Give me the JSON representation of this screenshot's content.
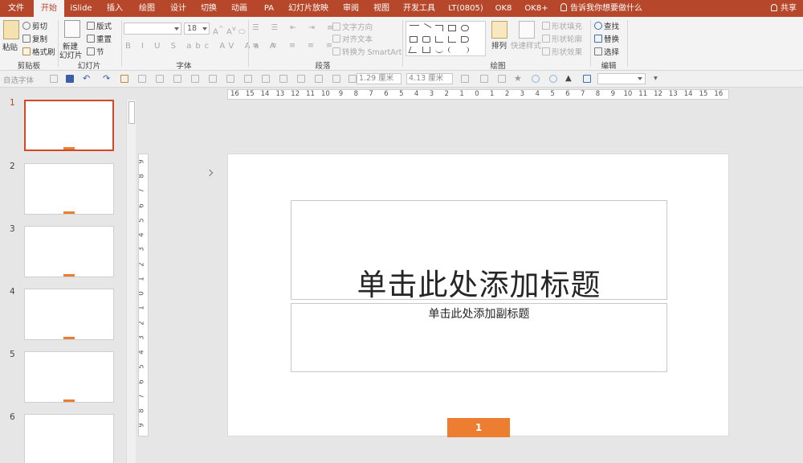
{
  "tabs": [
    "文件",
    "开始",
    "iSlide",
    "插入",
    "绘图",
    "设计",
    "切换",
    "动画",
    "PA",
    "幻灯片放映",
    "审阅",
    "视图",
    "开发工具",
    "LT(0805)",
    "OK8",
    "OK8+"
  ],
  "active_tab": "开始",
  "tell_me": "告诉我你想要做什么",
  "share": "共享",
  "ribbon": {
    "clipboard": {
      "paste": "粘贴",
      "cut": "剪切",
      "copy": "复制",
      "format_painter": "格式刷",
      "label": "剪贴板"
    },
    "slides": {
      "new_slide": "新建\n幻灯片",
      "new_slide_a": "新建",
      "new_slide_b": "幻灯片",
      "layout": "版式",
      "reset": "重置",
      "section": "节",
      "label": "幻灯片"
    },
    "font": {
      "font_name": "",
      "font_size": "18",
      "label": "字体"
    },
    "paragraph": {
      "text_direction": "文字方向",
      "align_text": "对齐文本",
      "convert_smartart": "转换为 SmartArt",
      "label": "段落"
    },
    "drawing": {
      "arrange": "排列",
      "quick_styles": "快速样式",
      "shape_fill": "形状填充",
      "shape_outline": "形状轮廓",
      "shape_effects": "形状效果",
      "label": "绘图"
    },
    "editing": {
      "find": "查找",
      "replace": "替换",
      "select": "选择",
      "label": "编辑"
    }
  },
  "qat": {
    "font_placeholder": "自选字体",
    "height": "1.29 厘米",
    "width": "4.13 厘米",
    "style_combo": ""
  },
  "hruler_labels": [
    "16",
    "15",
    "14",
    "13",
    "12",
    "11",
    "10",
    "9",
    "8",
    "7",
    "6",
    "5",
    "4",
    "3",
    "2",
    "1",
    "0",
    "1",
    "2",
    "3",
    "4",
    "5",
    "6",
    "7",
    "8",
    "9",
    "10",
    "11",
    "12",
    "13",
    "14",
    "15",
    "16"
  ],
  "vruler_labels": [
    "9",
    "8",
    "7",
    "6",
    "5",
    "4",
    "3",
    "2",
    "1",
    "0",
    "1",
    "2",
    "3",
    "4",
    "5",
    "6",
    "7",
    "8",
    "9"
  ],
  "slides": [
    {
      "number": "1",
      "selected": true
    },
    {
      "number": "2",
      "selected": false
    },
    {
      "number": "3",
      "selected": false
    },
    {
      "number": "4",
      "selected": false
    },
    {
      "number": "5",
      "selected": false
    },
    {
      "number": "6",
      "selected": false
    }
  ],
  "slide": {
    "title_placeholder": "单击此处添加标题",
    "subtitle_placeholder": "单击此处添加副标题",
    "slide_number": "1"
  },
  "colors": {
    "ribbon_tab_bg": "#b7472a",
    "accent_orange": "#ed7d31",
    "selection_border": "#d24726"
  }
}
